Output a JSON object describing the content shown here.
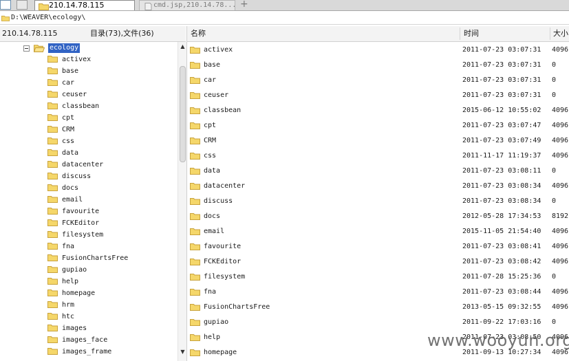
{
  "tabs": [
    {
      "label": "210.14.78.115",
      "active": true
    },
    {
      "label": "cmd.jsp,210.14.78...",
      "active": false
    }
  ],
  "tab_add": "+",
  "path": "D:\\WEAVER\\ecology\\",
  "left_header": {
    "host": "210.14.78.115",
    "summary": "目录(73),文件(36)"
  },
  "columns": {
    "name": "名称",
    "time": "时间",
    "size": "大小"
  },
  "tree": {
    "root": "ecology",
    "items": [
      "activex",
      "base",
      "car",
      "ceuser",
      "classbean",
      "cpt",
      "CRM",
      "css",
      "data",
      "datacenter",
      "discuss",
      "docs",
      "email",
      "favourite",
      "FCKEditor",
      "filesystem",
      "fna",
      "FusionChartsFree",
      "gupiao",
      "help",
      "homepage",
      "hrm",
      "htc",
      "images",
      "images_face",
      "images_frame"
    ]
  },
  "files": [
    {
      "name": "activex",
      "time": "2011-07-23 03:07:31",
      "size": "4096"
    },
    {
      "name": "base",
      "time": "2011-07-23 03:07:31",
      "size": "0"
    },
    {
      "name": "car",
      "time": "2011-07-23 03:07:31",
      "size": "0"
    },
    {
      "name": "ceuser",
      "time": "2011-07-23 03:07:31",
      "size": "0"
    },
    {
      "name": "classbean",
      "time": "2015-06-12 10:55:02",
      "size": "4096"
    },
    {
      "name": "cpt",
      "time": "2011-07-23 03:07:47",
      "size": "4096"
    },
    {
      "name": "CRM",
      "time": "2011-07-23 03:07:49",
      "size": "4096"
    },
    {
      "name": "css",
      "time": "2011-11-17 11:19:37",
      "size": "4096"
    },
    {
      "name": "data",
      "time": "2011-07-23 03:08:11",
      "size": "0"
    },
    {
      "name": "datacenter",
      "time": "2011-07-23 03:08:34",
      "size": "4096"
    },
    {
      "name": "discuss",
      "time": "2011-07-23 03:08:34",
      "size": "0"
    },
    {
      "name": "docs",
      "time": "2012-05-28 17:34:53",
      "size": "8192"
    },
    {
      "name": "email",
      "time": "2015-11-05 21:54:40",
      "size": "4096"
    },
    {
      "name": "favourite",
      "time": "2011-07-23 03:08:41",
      "size": "4096"
    },
    {
      "name": "FCKEditor",
      "time": "2011-07-23 03:08:42",
      "size": "4096"
    },
    {
      "name": "filesystem",
      "time": "2011-07-28 15:25:36",
      "size": "0"
    },
    {
      "name": "fna",
      "time": "2011-07-23 03:08:44",
      "size": "4096"
    },
    {
      "name": "FusionChartsFree",
      "time": "2013-05-15 09:32:55",
      "size": "4096"
    },
    {
      "name": "gupiao",
      "time": "2011-09-22 17:03:16",
      "size": "0"
    },
    {
      "name": "help",
      "time": "2011-07-23 03:08:50",
      "size": "4096"
    },
    {
      "name": "homepage",
      "time": "2011-09-13 10:27:34",
      "size": "4096"
    }
  ],
  "watermark": "www.wooyun.org",
  "colors": {
    "selection": "#3163c4",
    "folder": "#f5d76a",
    "folder_edge": "#c8a23c"
  }
}
